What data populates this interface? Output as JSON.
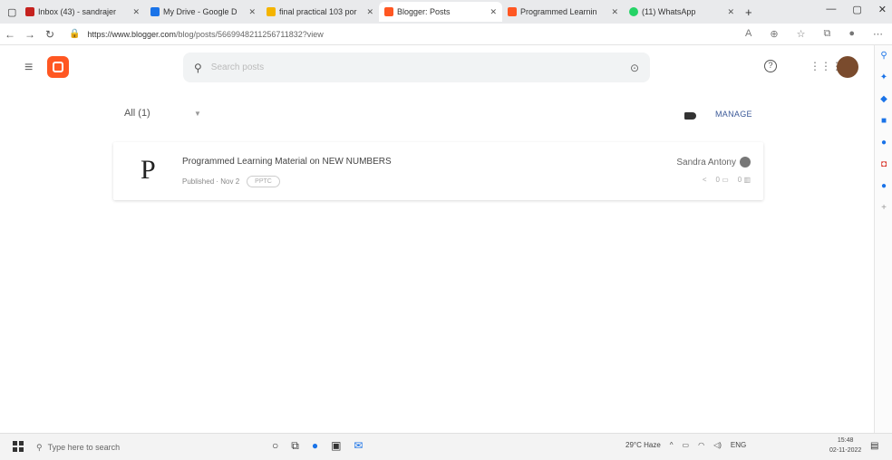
{
  "browser": {
    "tabs": [
      {
        "label": "Inbox (43) - sandrajer",
        "color": "#c5221f"
      },
      {
        "label": "My Drive - Google D",
        "color": "#1a73e8"
      },
      {
        "label": "final practical 103 por",
        "color": "#f4b400"
      },
      {
        "label": "Blogger: Posts",
        "color": "#ff5722",
        "active": true
      },
      {
        "label": "Programmed Learnin",
        "color": "#ff5722"
      },
      {
        "label": "(11) WhatsApp",
        "color": "#25d366"
      }
    ],
    "url_host": "https://www.blogger.com",
    "url_path": "/blog/posts/5669948211256711832?view",
    "window_controls": [
      "—",
      "▢",
      "✕"
    ]
  },
  "header": {
    "search_placeholder": "Search posts"
  },
  "toolbar": {
    "filter_label": "All (1)",
    "manage_label": "MANAGE"
  },
  "post": {
    "letter": "P",
    "title": "Programmed Learning Material on NEW NUMBERS",
    "status": "Published",
    "date": "Nov 2",
    "chip": "PPTC",
    "author": "Sandra Antony",
    "comments": "0",
    "views": "0"
  },
  "taskbar": {
    "search_placeholder": "Type here to search",
    "weather": "29°C Haze",
    "language": "ENG",
    "time": "15:48",
    "date": "02-11-2022"
  }
}
